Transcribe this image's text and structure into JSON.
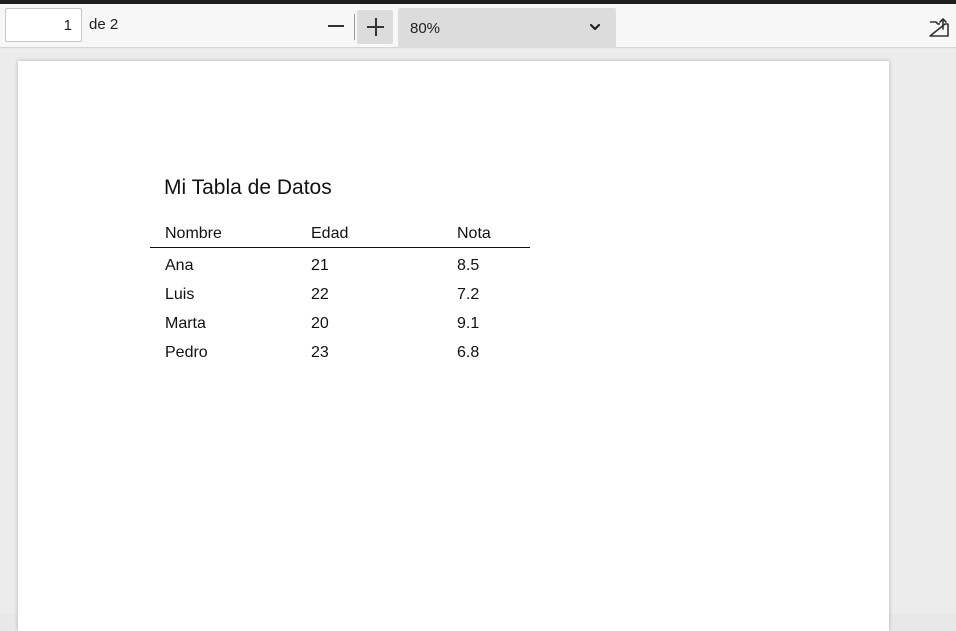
{
  "toolbar": {
    "page_current": "1",
    "page_total_label": "de 2",
    "zoom_value": "80%",
    "icons": {
      "zoom_out": "minus-icon",
      "zoom_in": "plus-icon",
      "dropdown": "chevron-down-icon",
      "open_external": "open-external-icon"
    }
  },
  "document": {
    "title": "Mi Tabla de Datos",
    "table": {
      "headers": [
        "Nombre",
        "Edad",
        "Nota"
      ],
      "rows": [
        [
          "Ana",
          "21",
          "8.5"
        ],
        [
          "Luis",
          "22",
          "7.2"
        ],
        [
          "Marta",
          "20",
          "9.1"
        ],
        [
          "Pedro",
          "23",
          "6.8"
        ]
      ]
    }
  },
  "colors": {
    "toolbar_bg": "#f7f7f7",
    "viewer_bg": "#ececec",
    "button_bg": "#dcdcdc",
    "text": "#111111"
  }
}
